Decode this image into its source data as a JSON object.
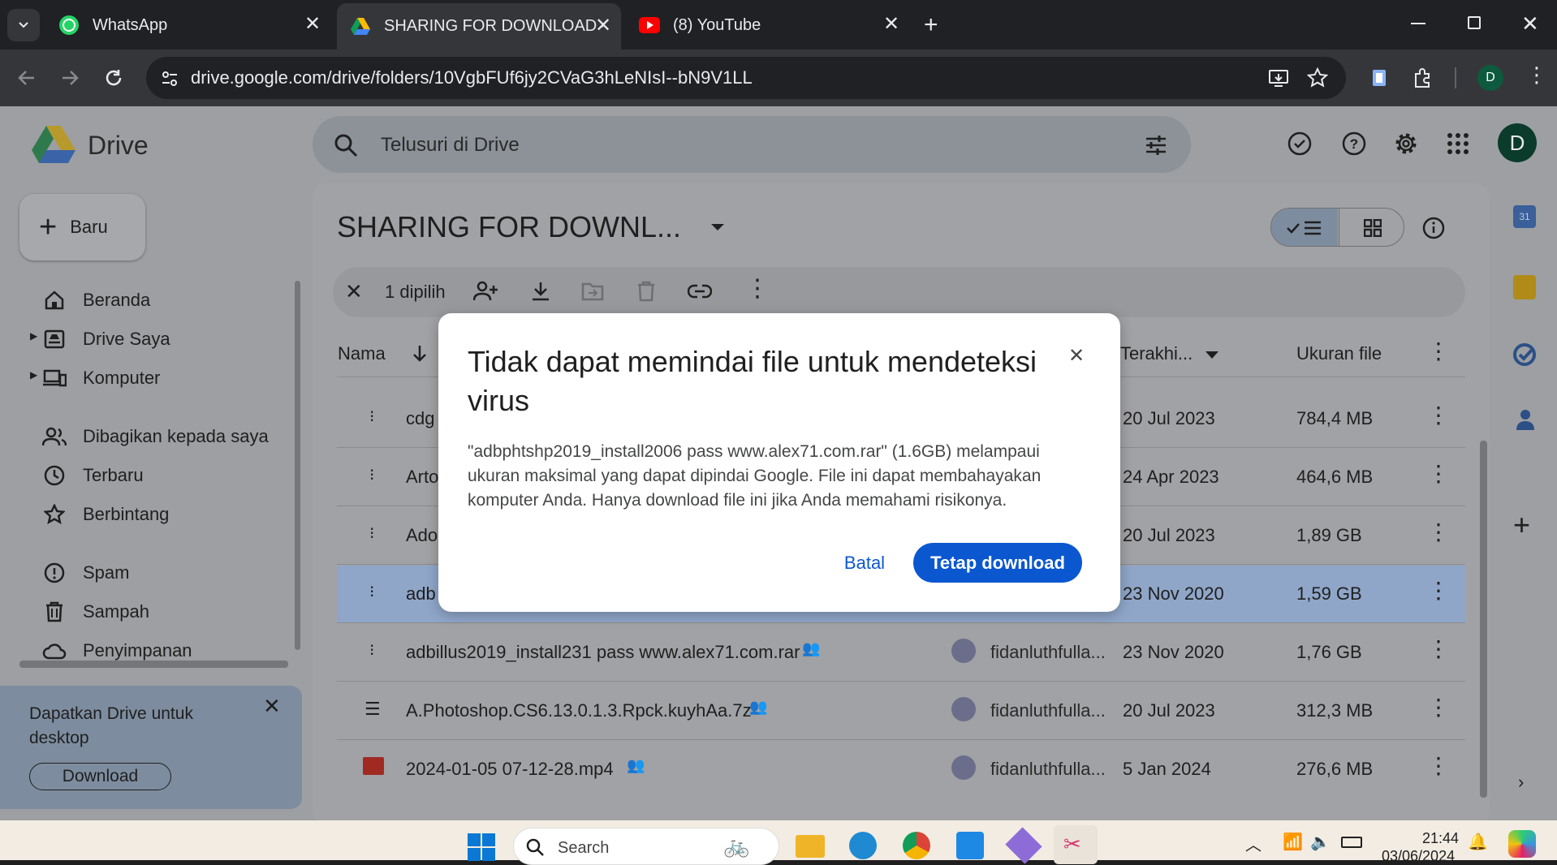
{
  "browser": {
    "tabs": [
      {
        "title": "WhatsApp",
        "icon": "whatsapp-icon"
      },
      {
        "title": "SHARING FOR DOWNLOAD - G",
        "icon": "google-drive-icon",
        "active": true
      },
      {
        "title": "(8) YouTube",
        "icon": "youtube-icon"
      }
    ],
    "url": "drive.google.com/drive/folders/10VgbFUf6jy2CVaG3hLeNIsI--bN9V1LL",
    "profile_initial": "D"
  },
  "drive": {
    "logo_text": "Drive",
    "search_placeholder": "Telusuri di Drive",
    "account_initial": "D",
    "new_button": "Baru",
    "nav": [
      {
        "label": "Beranda",
        "icon": "home-icon"
      },
      {
        "label": "Drive Saya",
        "icon": "my-drive-icon"
      },
      {
        "label": "Komputer",
        "icon": "computer-icon"
      },
      {
        "label": "Dibagikan kepada saya",
        "icon": "shared-icon"
      },
      {
        "label": "Terbaru",
        "icon": "clock-icon"
      },
      {
        "label": "Berbintang",
        "icon": "star-icon"
      },
      {
        "label": "Spam",
        "icon": "spam-icon"
      },
      {
        "label": "Sampah",
        "icon": "trash-icon"
      },
      {
        "label": "Penyimpanan",
        "icon": "cloud-icon"
      }
    ],
    "promo": {
      "text": "Dapatkan Drive untuk desktop",
      "button": "Download"
    },
    "folder_title": "SHARING FOR DOWNL...",
    "selection_count": "1 dipilih",
    "columns": {
      "name": "Nama",
      "modified": "Terakhi...",
      "size": "Ukuran file"
    },
    "files": [
      {
        "name": "cdg",
        "owner": "",
        "modified": "20 Jul 2023",
        "size": "784,4 MB",
        "icon": "archive-icon"
      },
      {
        "name": "Arto",
        "owner": "",
        "modified": "24 Apr 2023",
        "size": "464,6 MB",
        "icon": "archive-icon"
      },
      {
        "name": "Ado",
        "owner": "",
        "modified": "20 Jul 2023",
        "size": "1,89 GB",
        "icon": "archive-icon"
      },
      {
        "name": "adb",
        "owner": "",
        "modified": "23 Nov 2020",
        "size": "1,59 GB",
        "icon": "archive-icon",
        "selected": true
      },
      {
        "name": "adbillus2019_install231 pass www.alex71.com.rar",
        "owner": "fidanluthfulla...",
        "modified": "23 Nov 2020",
        "size": "1,76 GB",
        "icon": "archive-icon"
      },
      {
        "name": "A.Photoshop.CS6.13.0.1.3.Rpck.kuyhAa.7z",
        "owner": "fidanluthfulla...",
        "modified": "20 Jul 2023",
        "size": "312,3 MB",
        "icon": "list-file-icon"
      },
      {
        "name": "2024-01-05 07-12-28.mp4",
        "owner": "fidanluthfulla...",
        "modified": "5 Jan 2024",
        "size": "276,6 MB",
        "icon": "video-icon"
      }
    ]
  },
  "dialog": {
    "title": "Tidak dapat memindai file untuk mendeteksi virus",
    "body": "\"adbphtshp2019_install2006 pass www.alex71.com.rar\" (1.6GB) melampaui ukuran maksimal yang dapat dipindai Google. File ini dapat membahayakan komputer Anda. Hanya download file ini jika Anda memahami risikonya.",
    "cancel": "Batal",
    "confirm": "Tetap download"
  },
  "taskbar": {
    "search_placeholder": "Search",
    "time": "21:44",
    "date": "03/06/2024"
  },
  "colors": {
    "accent": "#0b57d0",
    "selected_row": "#8fa6c8",
    "promo_bg": "#a9bcd3"
  }
}
